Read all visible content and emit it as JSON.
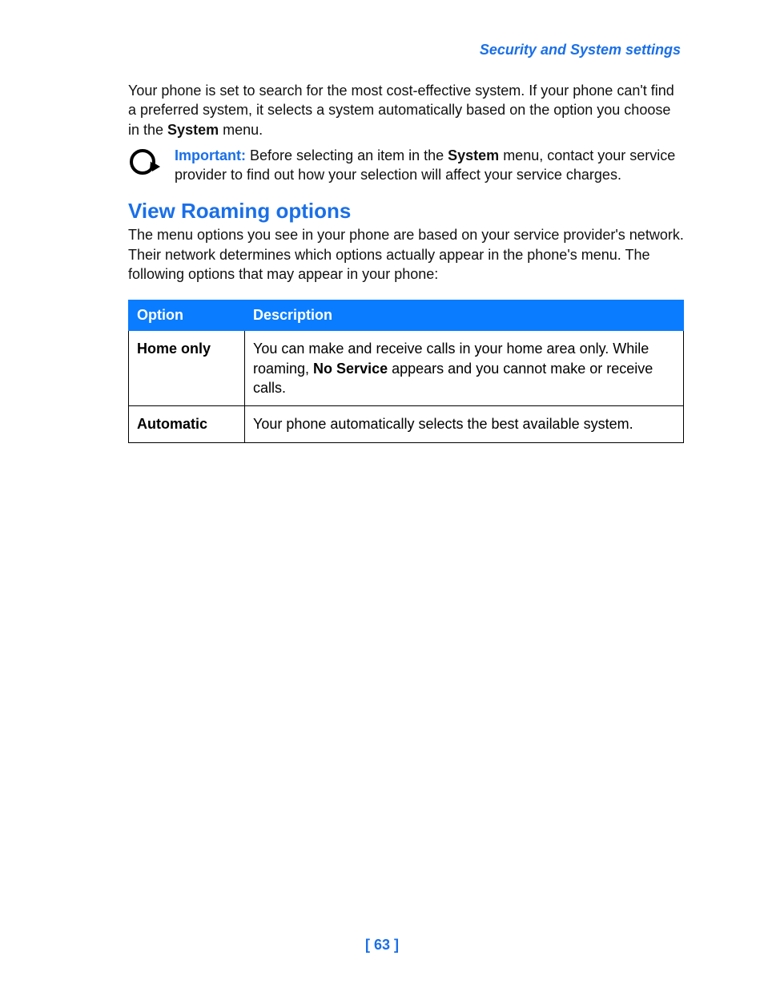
{
  "header": {
    "title": "Security and System settings"
  },
  "intro": {
    "line1": "Your phone is set to search for the most cost-effective system. If your phone can't find a preferred system, it selects a system automatically based on the option you choose in the ",
    "bold1": "System",
    "line2": " menu."
  },
  "important": {
    "label": "Important:",
    "text1": " Before selecting an item in the ",
    "bold1": "System",
    "text2": " menu, contact your service provider to find out how your selection will affect your service charges."
  },
  "section": {
    "heading": "View Roaming options",
    "para": "The menu options you see in your phone are based on your service provider's network. Their network determines which options actually appear in the phone's menu. The following options that may appear in your phone:"
  },
  "table": {
    "headers": {
      "col1": "Option",
      "col2": "Description"
    },
    "rows": [
      {
        "option": "Home only",
        "desc_pre": "You can make and receive calls in your home area only. While roaming, ",
        "desc_bold": "No Service",
        "desc_post": " appears and you cannot make or receive calls."
      },
      {
        "option": "Automatic",
        "desc_pre": "Your phone automatically selects the best available system.",
        "desc_bold": "",
        "desc_post": ""
      }
    ]
  },
  "footer": {
    "page_number": "[ 63 ]"
  }
}
